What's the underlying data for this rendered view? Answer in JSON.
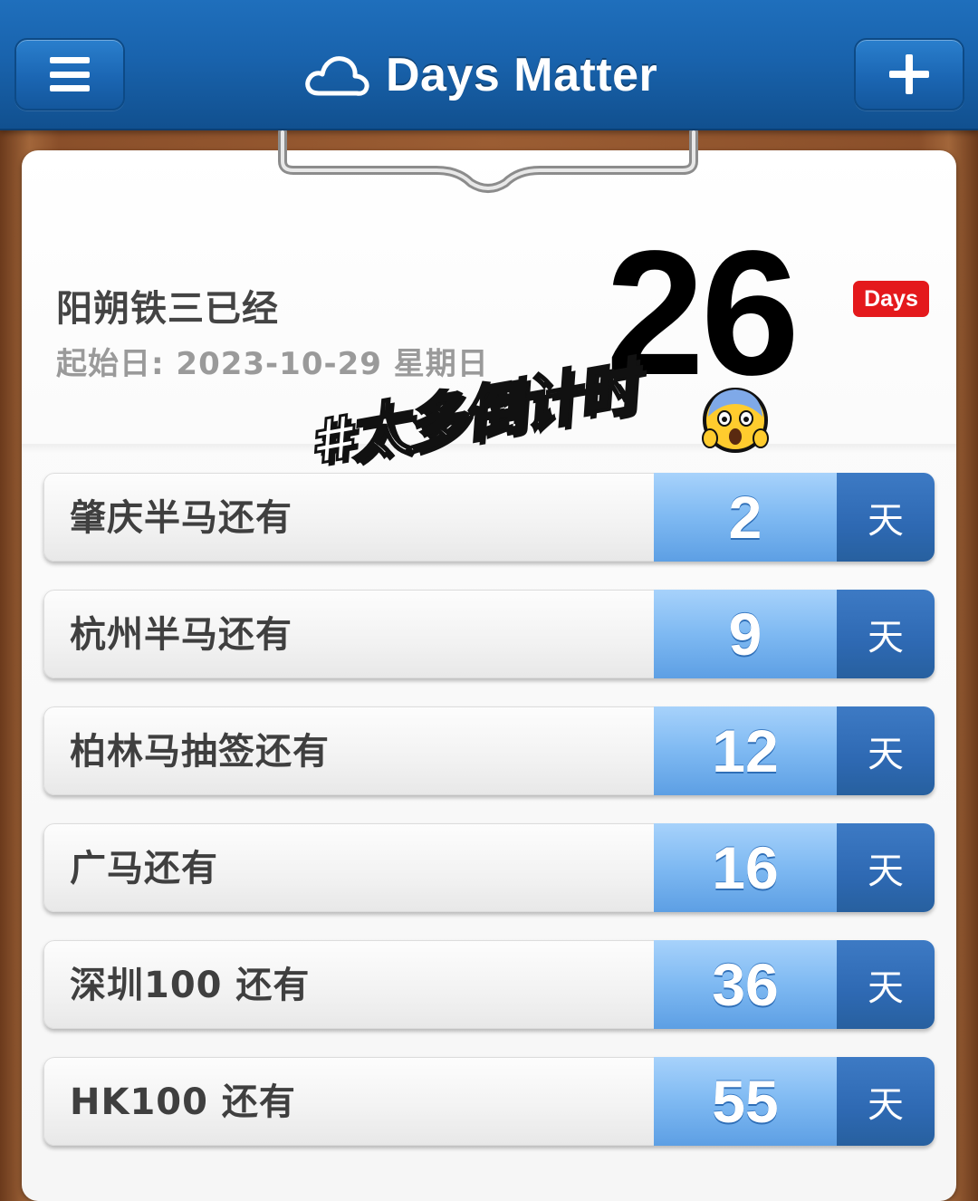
{
  "header": {
    "title": "Days Matter",
    "menu_icon": "menu-icon",
    "add_icon": "plus-icon",
    "cloud_icon": "cloud-icon",
    "bar_color": "#1963ad"
  },
  "hero": {
    "name": "阳朔铁三已经",
    "start_date": "起始日: 2023-10-29 星期日",
    "count": "26",
    "badge": "Days",
    "badge_color": "#e4191c"
  },
  "overlay": {
    "sticker": "#太多倒计时",
    "emoji": "😱"
  },
  "events": [
    {
      "label": "肇庆半马还有",
      "days": "2",
      "unit": "天"
    },
    {
      "label": "杭州半马还有",
      "days": "9",
      "unit": "天"
    },
    {
      "label": "柏林马抽签还有",
      "days": "12",
      "unit": "天"
    },
    {
      "label": "广马还有",
      "days": "16",
      "unit": "天"
    },
    {
      "label": "深圳100 还有",
      "days": "36",
      "unit": "天"
    },
    {
      "label": "HK100 还有",
      "days": "55",
      "unit": "天"
    }
  ]
}
